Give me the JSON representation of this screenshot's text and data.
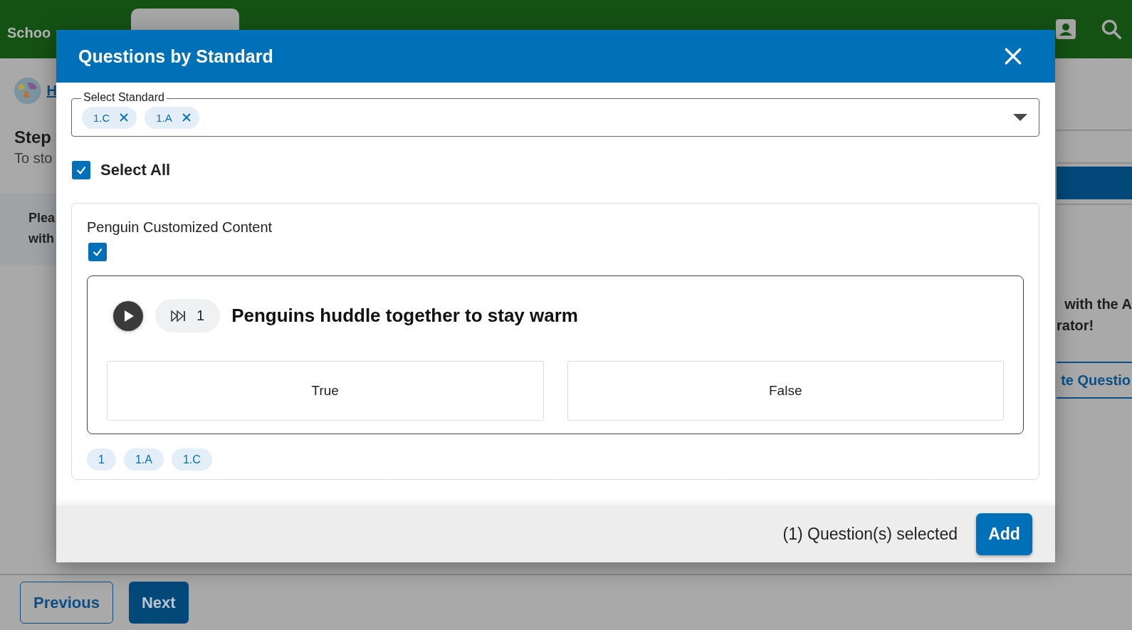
{
  "nav": {
    "brand": "Schoo"
  },
  "page": {
    "link": "H",
    "heading": "Step",
    "subheading": "To sto",
    "notice": [
      "Plea",
      "with"
    ],
    "side_text": [
      "with the A",
      "rator!"
    ],
    "side_button": "te Questio"
  },
  "modal": {
    "title": "Questions by Standard",
    "select": {
      "label": "Select Standard",
      "chips": [
        "1.C",
        "1.A"
      ]
    },
    "select_all": {
      "label": "Select All",
      "checked": true
    },
    "group": {
      "title": "Penguin Customized Content",
      "checked": true,
      "question": {
        "text": "Penguins huddle together to stay warm",
        "counter": "1",
        "answers": [
          "True",
          "False"
        ]
      },
      "tags": [
        "1",
        "1.A",
        "1.C"
      ]
    },
    "footer": {
      "status": "(1) Question(s) selected",
      "button": "Add"
    }
  },
  "nav_buttons": [
    {
      "label": "Previous",
      "kind": "outline"
    },
    {
      "label": "Next",
      "kind": "filled"
    }
  ]
}
